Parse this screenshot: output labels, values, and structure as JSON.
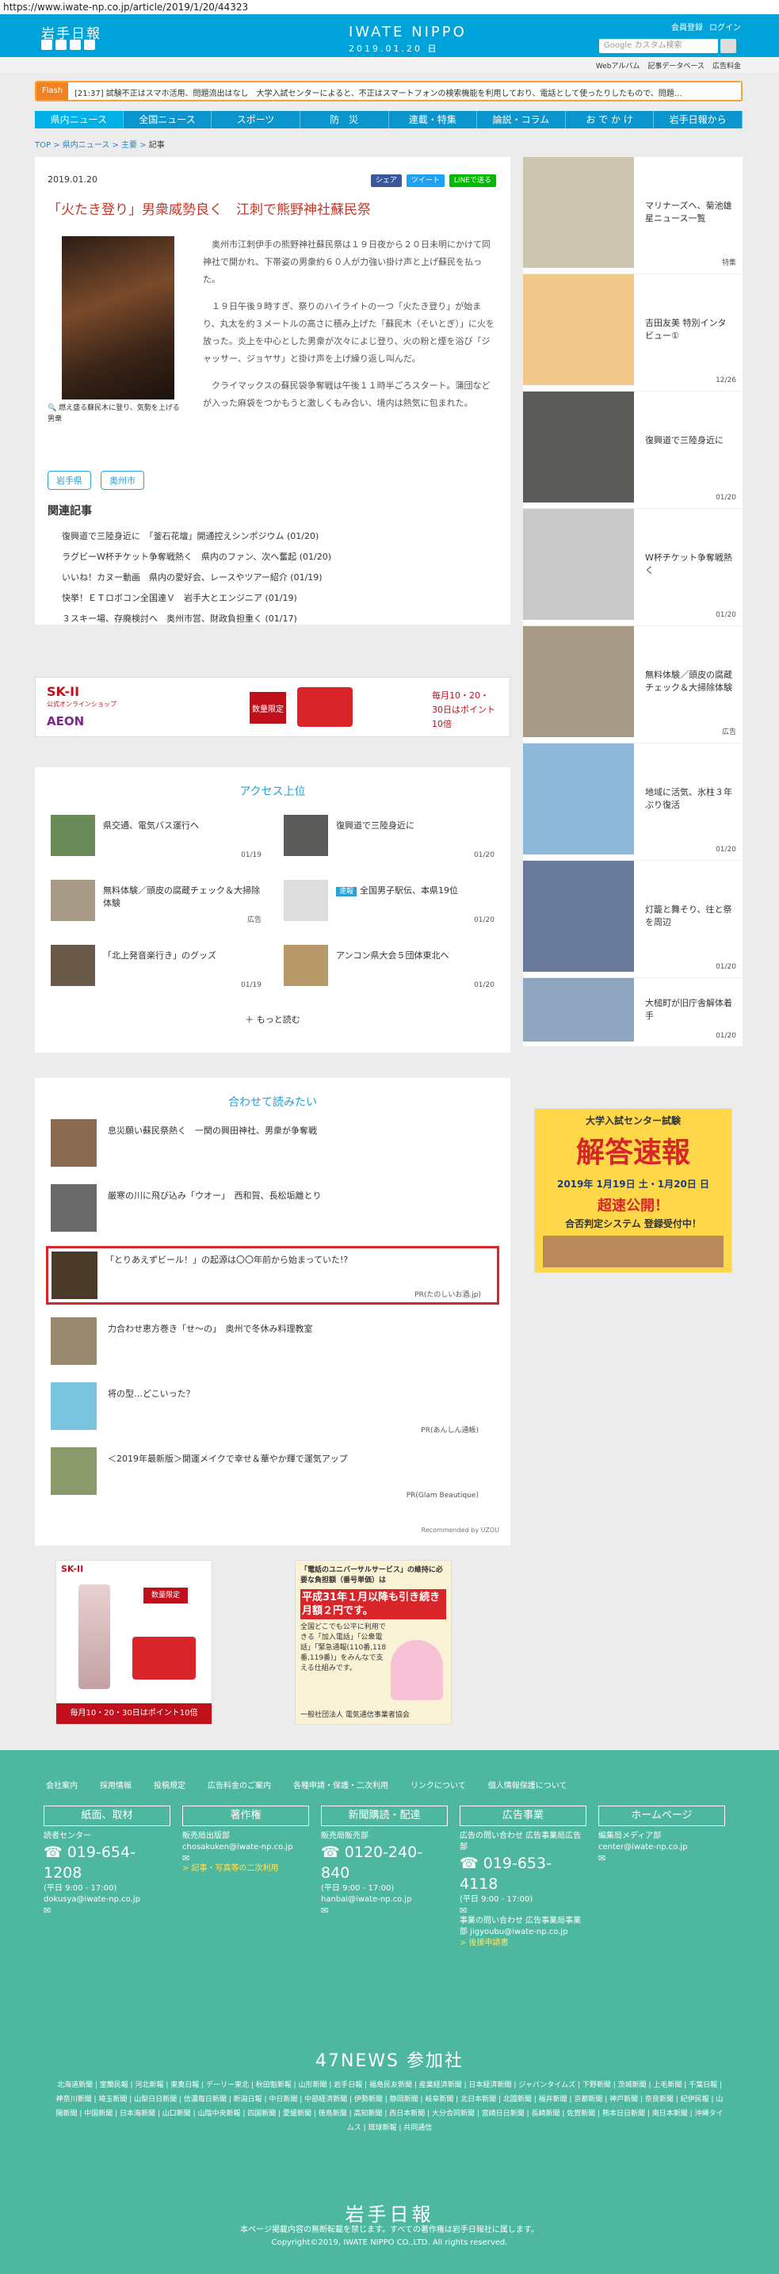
{
  "browser": {
    "url": "https://www.iwate-np.co.jp/article/2019/1/20/44323"
  },
  "header": {
    "logo": "岩手日報",
    "brand": "IWATE NIPPO",
    "date": "2019.01.20 日",
    "member": "会員登録",
    "login": "ログイン",
    "search_placeholder": "Google カスタム検索"
  },
  "subnav": [
    "Webアルバム",
    "記事データベース",
    "広告料金"
  ],
  "flash": {
    "tag": "Flash",
    "text": "[21:37] 試験不正はスマホ活用、問題流出はなし　大学入試センターによると、不正はスマートフォンの検索機能を利用しており、電話として使ったりしたもので、問題…"
  },
  "nav": [
    "県内ニュース",
    "全国ニュース",
    "スポーツ",
    "防　災",
    "連載・特集",
    "論説・コラム",
    "お で か け",
    "岩手日報から"
  ],
  "breadcrumb": {
    "top": "TOP",
    "cat": "県内ニュース",
    "sub": "主要",
    "cur": "記事"
  },
  "article": {
    "date": "2019.01.20",
    "share": [
      "シェア",
      "ツイート",
      "LINEで送る"
    ],
    "title": "「火たき登り」男衆威勢良く　江刺で熊野神社蘇民祭",
    "caption": "燃え盛る蘇民木に登り、気勢を上げる男衆",
    "paragraphs": [
      "奥州市江刺伊手の熊野神社蘇民祭は１９日夜から２０日未明にかけて同神社で開かれ、下帯姿の男衆約６０人が力強い掛け声と上げ蘇民を払った。",
      "１９日午後９時すぎ、祭りのハイライトの一つ「火たき登り」が始まり、丸太を約３メートルの高さに積み上げた「蘇民木（そいとぎ）」に火を放った。炎上を中心とした男衆が次々によじ登り、火の粉と煙を浴び「ジャッサー、ジョヤサ」と掛け声を上げ繰り返し叫んだ。",
      "クライマックスの蘇民袋争奪戦は午後１１時半ごろスタート。蒲団などが入った麻袋をつかもうと激しくもみ合い、境内は熱気に包まれた。"
    ],
    "tags": [
      "岩手県",
      "奥州市"
    ],
    "related_heading": "関連記事",
    "related": [
      "復興道で三陸身近に　「釜石花壇」開通控えシンポジウム (01/20)",
      "ラグビーW杯チケット争奪戦熱く　県内のファン、次へ奮起 (01/20)",
      "いいね！カヌー動画　県内の愛好会、レースやツアー紹介 (01/19)",
      "快挙！ＥＴロボコン全国連Ｖ　岩手大とエンジニア (01/19)",
      "３スキー場、存廃検討へ　奥州市営、財政負担重く (01/17)"
    ]
  },
  "ad1": {
    "brand": "SK-II",
    "shop": "公式オンラインショップ",
    "mall": "AEON",
    "badge": "数量限定",
    "promo": "毎月10・20・30日はポイント10倍"
  },
  "access": {
    "heading": "アクセス上位",
    "items": [
      {
        "title": "県交通、電気バス運行へ",
        "date": "01/19"
      },
      {
        "title": "復興道で三陸身近に",
        "date": "01/20"
      },
      {
        "title": "無料体験／頭皮の腐蔵チェック＆大掃除体験",
        "date": "広告"
      },
      {
        "badge": "速報",
        "title": "全国男子駅伝、本県19位",
        "date": "01/20"
      },
      {
        "title": "「北上発音楽行き」のグッズ",
        "date": "01/19"
      },
      {
        "title": "アンコン県大会５団体東北へ",
        "date": "01/20"
      }
    ],
    "more": "もっと読む"
  },
  "recommend": {
    "heading": "合わせて読みたい",
    "items": [
      {
        "title": "息災願い蘇民祭熱く　一関の興田神社、男衆が争奪戦",
        "pr": ""
      },
      {
        "title": "厳寒の川に飛び込み「ウオー」　西和賀、長松垢離とり",
        "pr": ""
      },
      {
        "title": "「とりあえずビール！」の起源は〇〇年前から始まっていた!?",
        "pr": "PR(たのしいお酒.jp)"
      },
      {
        "title": "力合わせ恵方巻き「せ～の」　奥州で冬休み料理教室",
        "pr": ""
      },
      {
        "title": "将の型…どこいった？",
        "pr": "PR(あんしん通帳)"
      },
      {
        "title": "＜2019年最新版＞開運メイクで幸せ＆華やか輝で運気アップ",
        "pr": "PR(Glam Beautique)"
      }
    ],
    "credit": "Recommended by UZOU"
  },
  "bottom_ads": {
    "left": {
      "brand": "SK-II",
      "badge": "数量限定",
      "promo": "毎月10・20・30日はポイント10倍"
    },
    "right": {
      "line1": "「電話のユニバーサルサービス」の維持に必要な負担額（番号単価）は",
      "line2": "平成31年１月以降も引き続き月額２円です。",
      "line3": "全国どこでも公平に利用できる「加入電話」「公衆電話」「緊急通報(110番,118番,119番)」をみんなで支える仕組みです。",
      "line4": "一般社団法人 電気通信事業者協会"
    }
  },
  "sidebar": [
    {
      "title": "マリナーズへ、菊池雄星ニュース一覧",
      "date": "特集",
      "color": "#cfc6b2"
    },
    {
      "title": "吉田友美 特別インタビュー①",
      "date": "12/26",
      "color": "#f0c88a"
    },
    {
      "title": "復興道で三陸身近に",
      "date": "01/20",
      "color": "#5a5a58"
    },
    {
      "title": "W杯チケット争奪戦熱く",
      "date": "01/20",
      "color": "#c9c9c9"
    },
    {
      "title": "無料体験／頭皮の腐蔵チェック＆大掃除体験",
      "date": "広告",
      "color": "#a79a86"
    },
    {
      "title": "地域に活気、氷柱３年ぶり復活",
      "date": "01/20",
      "color": "#8fb8d8"
    },
    {
      "title": "灯籠と舞そり、往と祭を周辺",
      "date": "01/20",
      "color": "#6a7a9a"
    },
    {
      "title": "大槌町が旧庁舎解体着手",
      "date": "01/20",
      "color": "#8ea6c0"
    }
  ],
  "side_ad": {
    "l1": "大学入試センター試験",
    "l2": "解答速報",
    "l3": "2019年 1月19日 土・1月20日 日",
    "l4": "超速公開！",
    "l5": "合否判定システム 登録受付中！"
  },
  "footer": {
    "links": [
      "会社案内",
      "採用情報",
      "投稿規定",
      "広告料金のご案内",
      "各種申請・保護・二次利用",
      "リンクについて",
      "個人情報保護について"
    ],
    "cols": [
      {
        "box": "紙面、取材",
        "a": "読者センター",
        "tel": "019-654-1208",
        "m": "(平日 9:00 - 17:00)",
        "mail": "dokusya@iwate-np.co.jp",
        "extra": ""
      },
      {
        "box": "著作権",
        "a": "販売局出版部",
        "tel": "",
        "m": "chosakuken@iwate-np.co.jp",
        "mail": "",
        "extra": "> 記事・写真等の二次利用"
      },
      {
        "box": "新聞購読・配達",
        "a": "販売局販売部",
        "tel": "0120-240-840",
        "m": "(平日 9:00 - 17:00)",
        "mail": "hanbai@iwate-np.co.jp",
        "extra": ""
      },
      {
        "box": "広告事業",
        "a": "広告の問い合わせ 広告事業局広告部",
        "tel": "019-653-4118",
        "m": "(平日 9:00 - 17:00)",
        "mail": "事業の問い合わせ 広告事業局事業部 jigyoubu@iwate-np.co.jp",
        "extra": "> 後援申請書"
      },
      {
        "box": "ホームページ",
        "a": "編集局メディア部",
        "tel": "",
        "m": "center@iwate-np.co.jp",
        "mail": "",
        "extra": ""
      }
    ],
    "news47": "47NEWS 参加社",
    "papers": "北海道新聞 | 室蘭民報 | 河北新報 | 東奥日報 | デーリー東北 | 秋田魁新報 | 山形新聞 | 岩手日報 | 福島民友新聞 | 産業経済新聞 | 日本経済新聞 | ジャパンタイムズ | 下野新聞 | 茨城新聞 | 上毛新聞 | 千葉日報 | 神奈川新聞 | 埼玉新聞 | 山梨日日新聞 | 信濃毎日新聞 | 新潟日報 | 中日新聞 | 中部経済新聞 | 伊勢新聞 | 静岡新聞 | 岐阜新聞 | 北日本新聞 | 北國新聞 | 福井新聞 | 京都新聞 | 神戸新聞 | 奈良新聞 | 紀伊民報 | 山陽新聞 | 中国新聞 | 日本海新聞 | 山口新聞 | 山陰中央新報 | 四国新聞 | 愛媛新聞 | 徳島新聞 | 高知新聞 | 西日本新聞 | 大分合同新聞 | 宮崎日日新聞 | 長崎新聞 | 佐賀新聞 | 熊本日日新聞 | 南日本新聞 | 沖縄タイムス | 琉球新報 | 共同通信",
    "logo": "岩手日報",
    "note": "本ページ掲載内容の無断転載を禁じます。すべての著作権は岩手日報社に属します。",
    "copy": "Copyright©2019, IWATE NIPPO CO.,LTD. All rights reserved."
  }
}
